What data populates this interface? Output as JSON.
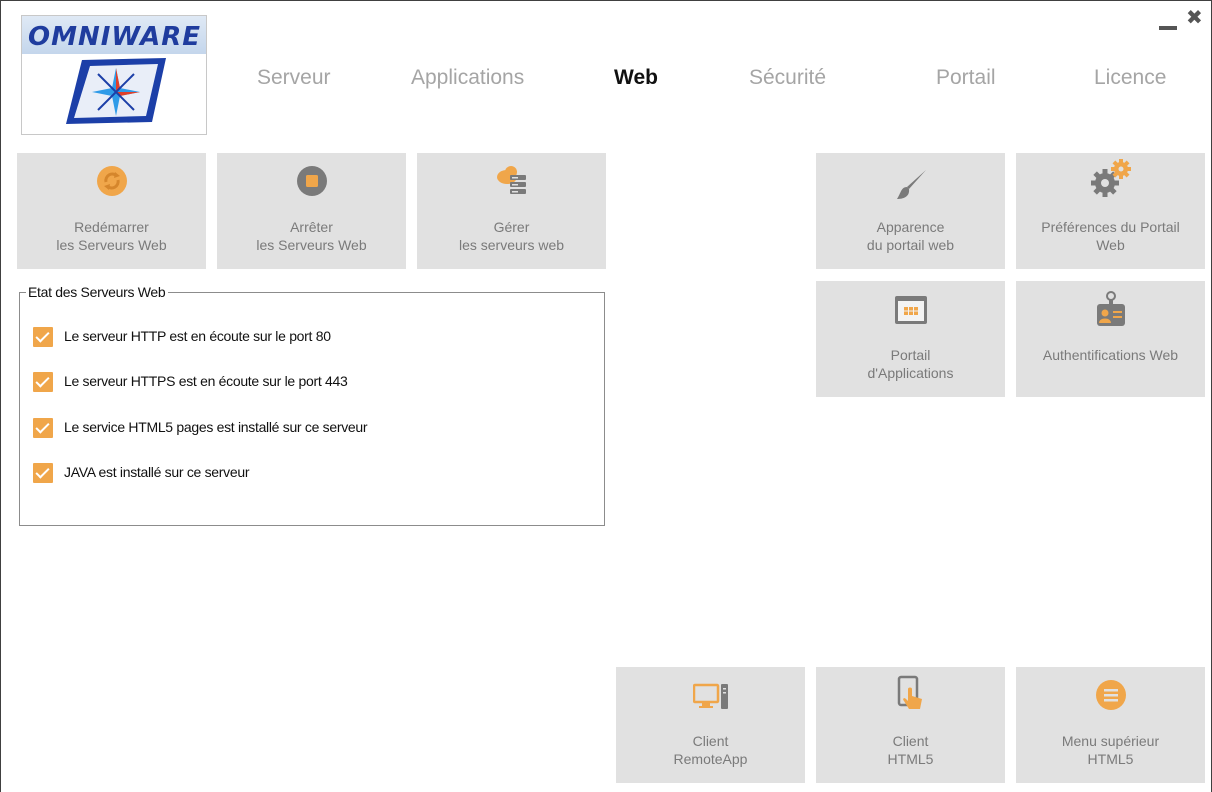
{
  "app": {
    "logo_text": "OMNIWARE",
    "window_controls": {
      "minimize": "minimize-icon",
      "close": "close-icon"
    }
  },
  "nav": {
    "tabs": [
      {
        "label": "Serveur",
        "active": false
      },
      {
        "label": "Applications",
        "active": false
      },
      {
        "label": "Web",
        "active": true
      },
      {
        "label": "Sécurité",
        "active": false
      },
      {
        "label": "Portail",
        "active": false
      },
      {
        "label": "Licence",
        "active": false
      }
    ]
  },
  "actions": {
    "restart": {
      "line1": "Redémarrer",
      "line2": "les Serveurs Web",
      "icon": "restart-icon"
    },
    "stop": {
      "line1": "Arrêter",
      "line2": "les Serveurs Web",
      "icon": "stop-icon"
    },
    "manage": {
      "line1": "Gérer",
      "line2": "les serveurs web",
      "icon": "cloud-server-icon"
    },
    "appearance": {
      "line1": "Apparence",
      "line2": "du portail web",
      "icon": "paintbrush-icon"
    },
    "preferences": {
      "line1": "Préférences du Portail",
      "line2": "Web",
      "icon": "gears-icon"
    },
    "app_portal": {
      "line1": "Portail",
      "line2": "d'Applications",
      "icon": "app-grid-icon"
    },
    "web_auth": {
      "line1": "Authentifications Web",
      "line2": "",
      "icon": "id-badge-icon"
    },
    "client_remoteapp": {
      "line1": "Client",
      "line2": "RemoteApp",
      "icon": "computer-icon"
    },
    "client_html5": {
      "line1": "Client",
      "line2": "HTML5",
      "icon": "touch-device-icon"
    },
    "html5_topmenu": {
      "line1": "Menu supérieur",
      "line2": "HTML5",
      "icon": "menu-icon"
    }
  },
  "status": {
    "title": "Etat des Serveurs Web",
    "items": [
      {
        "label": "Le serveur HTTP est en écoute sur le port 80",
        "checked": true
      },
      {
        "label": "Le serveur HTTPS est en écoute sur le port 443",
        "checked": true
      },
      {
        "label": "Le service HTML5 pages est installé sur ce serveur",
        "checked": true
      },
      {
        "label": "JAVA est installé sur ce serveur",
        "checked": true
      }
    ]
  },
  "colors": {
    "accent": "#f0a64a",
    "tile_bg": "#e1e1e1",
    "tab_inactive": "#a5a5a5",
    "tab_active": "#111111",
    "logo_blue": "#1f3c9e"
  }
}
